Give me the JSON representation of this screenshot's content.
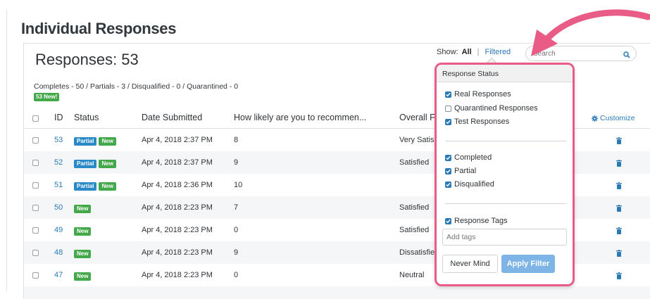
{
  "page": {
    "title": "Individual Responses"
  },
  "responses": {
    "count_label": "Responses: 53",
    "summary": "Completes - 50 / Partials - 3 / Disqualified - 0 / Quarantined - 0",
    "new_badge": "53 New!"
  },
  "show": {
    "label": "Show:",
    "all": "All",
    "separator": "|",
    "filtered": "Filtered"
  },
  "search": {
    "placeholder": "Search"
  },
  "table": {
    "columns": [
      "ID",
      "Status",
      "Date Submitted",
      "How likely are you to recommen...",
      "Overall F"
    ],
    "customize_label": "Customize",
    "rows": [
      {
        "id": "53",
        "tags": [
          "Partial",
          "New"
        ],
        "date": "Apr 4, 2018 2:37 PM",
        "score": "8",
        "overall": "Very Satis"
      },
      {
        "id": "52",
        "tags": [
          "Partial",
          "New"
        ],
        "date": "Apr 4, 2018 2:37 PM",
        "score": "9",
        "overall": "Satisfied"
      },
      {
        "id": "51",
        "tags": [
          "Partial",
          "New"
        ],
        "date": "Apr 4, 2018 2:36 PM",
        "score": "10",
        "overall": ""
      },
      {
        "id": "50",
        "tags": [
          "New"
        ],
        "date": "Apr 4, 2018 2:23 PM",
        "score": "7",
        "overall": "Satisfied"
      },
      {
        "id": "49",
        "tags": [
          "New"
        ],
        "date": "Apr 4, 2018 2:23 PM",
        "score": "0",
        "overall": "Satisfied"
      },
      {
        "id": "48",
        "tags": [
          "New"
        ],
        "date": "Apr 4, 2018 2:23 PM",
        "score": "9",
        "overall": "Dissatisfie"
      },
      {
        "id": "47",
        "tags": [
          "New"
        ],
        "date": "Apr 4, 2018 2:23 PM",
        "score": "0",
        "overall": "Neutral"
      }
    ]
  },
  "filter": {
    "header": "Response Status",
    "group1": [
      {
        "label": "Real Responses",
        "checked": true
      },
      {
        "label": "Quarantined Responses",
        "checked": false
      },
      {
        "label": "Test Responses",
        "checked": true
      }
    ],
    "group2": [
      {
        "label": "Completed",
        "checked": true
      },
      {
        "label": "Partial",
        "checked": true
      },
      {
        "label": "Disqualified",
        "checked": true
      }
    ],
    "tags_option": {
      "label": "Response Tags",
      "checked": true
    },
    "tags_placeholder": "Add tags",
    "never_mind": "Never Mind",
    "apply": "Apply Filter"
  },
  "colors": {
    "link": "#2a7ab8",
    "partial_tag": "#2a8ac8",
    "new_tag": "#43a84a",
    "highlight_border": "#e95c85",
    "apply_button": "#7fb4e6"
  }
}
